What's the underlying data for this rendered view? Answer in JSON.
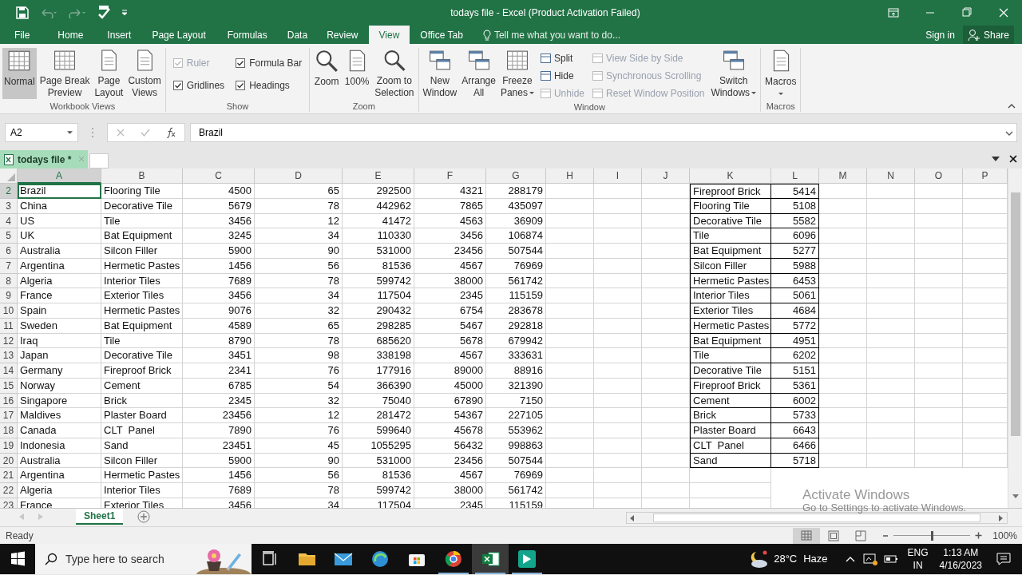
{
  "window": {
    "title": "todays file - Excel (Product Activation Failed)"
  },
  "tabs": [
    {
      "label": "File",
      "selected": false
    },
    {
      "label": "Home",
      "selected": false
    },
    {
      "label": "Insert",
      "selected": false
    },
    {
      "label": "Page Layout",
      "selected": false
    },
    {
      "label": "Formulas",
      "selected": false
    },
    {
      "label": "Data",
      "selected": false
    },
    {
      "label": "Review",
      "selected": false
    },
    {
      "label": "View",
      "selected": true
    },
    {
      "label": "Office Tab",
      "selected": false
    }
  ],
  "tell_me": {
    "placeholder": "Tell me what you want to do..."
  },
  "account": {
    "sign_in": "Sign in",
    "share": "Share"
  },
  "ribbon": {
    "groups": [
      {
        "label": "Workbook Views",
        "items": [
          {
            "kind": "big",
            "lines": [
              "Normal"
            ],
            "selected": true
          },
          {
            "kind": "big",
            "lines": [
              "Page Break",
              "Preview"
            ],
            "selected": false
          },
          {
            "kind": "big",
            "lines": [
              "Page",
              "Layout"
            ],
            "selected": false
          },
          {
            "kind": "big",
            "lines": [
              "Custom",
              "Views"
            ],
            "selected": false
          }
        ]
      },
      {
        "label": "Show",
        "items": [
          {
            "kind": "check",
            "label": "Ruler",
            "checked": true,
            "disabled": true
          },
          {
            "kind": "check",
            "label": "Gridlines",
            "checked": true,
            "disabled": false
          },
          {
            "kind": "check",
            "label": "Formula Bar",
            "checked": true,
            "disabled": false
          },
          {
            "kind": "check",
            "label": "Headings",
            "checked": true,
            "disabled": false
          }
        ]
      },
      {
        "label": "Zoom",
        "items": [
          {
            "kind": "big",
            "lines": [
              "Zoom"
            ]
          },
          {
            "kind": "big",
            "lines": [
              "100%"
            ]
          },
          {
            "kind": "big",
            "lines": [
              "Zoom to",
              "Selection"
            ]
          }
        ]
      },
      {
        "label": "Window",
        "items": [
          {
            "kind": "big",
            "lines": [
              "New",
              "Window"
            ]
          },
          {
            "kind": "big",
            "lines": [
              "Arrange",
              "All"
            ]
          },
          {
            "kind": "big",
            "lines": [
              "Freeze",
              "Panes"
            ],
            "dropdown": true
          },
          {
            "kind": "small",
            "label": "Split",
            "disabled": false
          },
          {
            "kind": "small",
            "label": "Hide",
            "disabled": false
          },
          {
            "kind": "small",
            "label": "Unhide",
            "disabled": true
          },
          {
            "kind": "small",
            "label": "View Side by Side",
            "disabled": true
          },
          {
            "kind": "small",
            "label": "Synchronous Scrolling",
            "disabled": true
          },
          {
            "kind": "small",
            "label": "Reset Window Position",
            "disabled": true
          },
          {
            "kind": "big",
            "lines": [
              "Switch",
              "Windows"
            ],
            "dropdown": true
          }
        ]
      },
      {
        "label": "Macros",
        "items": [
          {
            "kind": "big",
            "lines": [
              "Macros"
            ],
            "dropdown": true
          }
        ]
      }
    ]
  },
  "formula_bar": {
    "name_box": "A2",
    "value": "Brazil"
  },
  "document_tab": {
    "label": "todays file *"
  },
  "sheet": {
    "columns": [
      {
        "label": "A",
        "selected": true
      },
      {
        "label": "B",
        "selected": false
      },
      {
        "label": "C",
        "selected": false
      },
      {
        "label": "D",
        "selected": false
      },
      {
        "label": "E",
        "selected": false
      },
      {
        "label": "F",
        "selected": false
      },
      {
        "label": "G",
        "selected": false
      },
      {
        "label": "H",
        "selected": false
      },
      {
        "label": "I",
        "selected": false
      },
      {
        "label": "J",
        "selected": false
      },
      {
        "label": "K",
        "selected": false
      },
      {
        "label": "L",
        "selected": false
      },
      {
        "label": "M",
        "selected": false
      },
      {
        "label": "N",
        "selected": false
      },
      {
        "label": "O",
        "selected": false
      },
      {
        "label": "P",
        "selected": false
      }
    ],
    "rows": [
      {
        "header": "2",
        "selected": true,
        "main": [
          "Brazil",
          "Flooring Tile",
          "4500",
          "65",
          "292500",
          "4321",
          "288179"
        ],
        "lookup": [
          "Fireproof Brick",
          "5414"
        ]
      },
      {
        "header": "3",
        "selected": false,
        "main": [
          "China",
          "Decorative Tile",
          "5679",
          "78",
          "442962",
          "7865",
          "435097"
        ],
        "lookup": [
          "Flooring Tile",
          "5108"
        ]
      },
      {
        "header": "4",
        "selected": false,
        "main": [
          "US",
          "Tile",
          "3456",
          "12",
          "41472",
          "4563",
          "36909"
        ],
        "lookup": [
          "Decorative Tile",
          "5582"
        ]
      },
      {
        "header": "5",
        "selected": false,
        "main": [
          "UK",
          "Bat Equipment",
          "3245",
          "34",
          "110330",
          "3456",
          "106874"
        ],
        "lookup": [
          "Tile",
          "6096"
        ]
      },
      {
        "header": "6",
        "selected": false,
        "main": [
          "Australia",
          "Silcon Filler",
          "5900",
          "90",
          "531000",
          "23456",
          "507544"
        ],
        "lookup": [
          "Bat Equipment",
          "5277"
        ]
      },
      {
        "header": "7",
        "selected": false,
        "main": [
          "Argentina",
          "Hermetic Pastes",
          "1456",
          "56",
          "81536",
          "4567",
          "76969"
        ],
        "lookup": [
          "Silcon Filler",
          "5988"
        ]
      },
      {
        "header": "8",
        "selected": false,
        "main": [
          "Algeria",
          "Interior Tiles",
          "7689",
          "78",
          "599742",
          "38000",
          "561742"
        ],
        "lookup": [
          "Hermetic Pastes",
          "6453"
        ]
      },
      {
        "header": "9",
        "selected": false,
        "main": [
          "France",
          "Exterior Tiles",
          "3456",
          "34",
          "117504",
          "2345",
          "115159"
        ],
        "lookup": [
          "Interior Tiles",
          "5061"
        ]
      },
      {
        "header": "10",
        "selected": false,
        "main": [
          "Spain",
          "Hermetic Pastes",
          "9076",
          "32",
          "290432",
          "6754",
          "283678"
        ],
        "lookup": [
          "Exterior Tiles",
          "4684"
        ]
      },
      {
        "header": "11",
        "selected": false,
        "main": [
          "Sweden",
          "Bat Equipment",
          "4589",
          "65",
          "298285",
          "5467",
          "292818"
        ],
        "lookup": [
          "Hermetic Pastes",
          "5772"
        ]
      },
      {
        "header": "12",
        "selected": false,
        "main": [
          "Iraq",
          "Tile",
          "8790",
          "78",
          "685620",
          "5678",
          "679942"
        ],
        "lookup": [
          "Bat Equipment",
          "4951"
        ]
      },
      {
        "header": "13",
        "selected": false,
        "main": [
          "Japan",
          "Decorative Tile",
          "3451",
          "98",
          "338198",
          "4567",
          "333631"
        ],
        "lookup": [
          "Tile",
          "6202"
        ]
      },
      {
        "header": "14",
        "selected": false,
        "main": [
          "Germany",
          "Fireproof Brick",
          "2341",
          "76",
          "177916",
          "89000",
          "88916"
        ],
        "lookup": [
          "Decorative Tile",
          "5151"
        ]
      },
      {
        "header": "15",
        "selected": false,
        "main": [
          "Norway",
          "Cement",
          "6785",
          "54",
          "366390",
          "45000",
          "321390"
        ],
        "lookup": [
          "Fireproof Brick",
          "5361"
        ]
      },
      {
        "header": "16",
        "selected": false,
        "main": [
          "Singapore",
          "Brick",
          "2345",
          "32",
          "75040",
          "67890",
          "7150"
        ],
        "lookup": [
          "Cement",
          "6002"
        ]
      },
      {
        "header": "17",
        "selected": false,
        "main": [
          "Maldives",
          "Plaster Board",
          "23456",
          "12",
          "281472",
          "54367",
          "227105"
        ],
        "lookup": [
          "Brick",
          "5733"
        ]
      },
      {
        "header": "18",
        "selected": false,
        "main": [
          "Canada",
          "CLT  Panel",
          "7890",
          "76",
          "599640",
          "45678",
          "553962"
        ],
        "lookup": [
          "Plaster Board",
          "6643"
        ]
      },
      {
        "header": "19",
        "selected": false,
        "main": [
          "Indonesia",
          "Sand",
          "23451",
          "45",
          "1055295",
          "56432",
          "998863"
        ],
        "lookup": [
          "CLT  Panel",
          "6466"
        ]
      },
      {
        "header": "20",
        "selected": false,
        "main": [
          "Australia",
          "Silcon Filler",
          "5900",
          "90",
          "531000",
          "23456",
          "507544"
        ],
        "lookup": [
          "Sand",
          "5718"
        ]
      },
      {
        "header": "21",
        "selected": false,
        "main": [
          "Argentina",
          "Hermetic Pastes",
          "1456",
          "56",
          "81536",
          "4567",
          "76969"
        ]
      },
      {
        "header": "22",
        "selected": false,
        "main": [
          "Algeria",
          "Interior Tiles",
          "7689",
          "78",
          "599742",
          "38000",
          "561742"
        ]
      },
      {
        "header": "23",
        "selected": false,
        "main": [
          "France",
          "Exterior Tiles",
          "3456",
          "34",
          "117504",
          "2345",
          "115159"
        ]
      }
    ]
  },
  "sheet_tabs": [
    {
      "label": "Sheet1",
      "selected": true
    }
  ],
  "status_bar": {
    "text": "Ready",
    "zoom": {
      "level": 0.5,
      "reading": "100%"
    }
  },
  "activation_notice": {
    "title": "Activate Windows",
    "subtitle": "Go to Settings to activate Windows."
  },
  "taskbar": {
    "search": {
      "placeholder": "Type here to search"
    },
    "apps": [
      {
        "running": false,
        "active": false
      },
      {
        "running": false,
        "active": false
      },
      {
        "running": false,
        "active": false
      },
      {
        "running": false,
        "active": false
      },
      {
        "running": true,
        "active": false
      },
      {
        "running": true,
        "active": true
      },
      {
        "running": true,
        "active": false
      }
    ],
    "weather": {
      "temperature": "28°C",
      "condition": "Haze"
    },
    "language": {
      "top": "ENG",
      "bottom": "IN"
    },
    "clock": {
      "time": "1:13 AM",
      "date": "4/16/2023"
    }
  }
}
